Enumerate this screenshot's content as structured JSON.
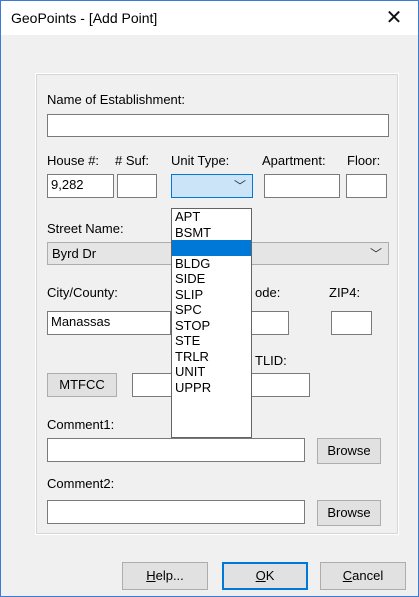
{
  "window": {
    "title": "GeoPoints - [Add Point]",
    "close": "✕"
  },
  "labels": {
    "name": "Name of Establishment:",
    "house": "House #:",
    "suf": "# Suf:",
    "unit_type": "Unit Type:",
    "apartment": "Apartment:",
    "floor": "Floor:",
    "street": "Street Name:",
    "city": "City/County:",
    "zip_code_partial": "ode:",
    "zip4": "ZIP4:",
    "tlid_partial": "TLID:",
    "comment1": "Comment1:",
    "comment2": "Comment2:"
  },
  "fields": {
    "name": "",
    "house": "9,282",
    "suf": "",
    "unit_type": "",
    "apartment": "",
    "floor": "",
    "street": "Byrd Dr",
    "city": "Manassas",
    "zip_partial": "0",
    "zip4": "",
    "mtfcc_value": "",
    "tlid": "",
    "comment1": "",
    "comment2": ""
  },
  "buttons": {
    "mtfcc": "MTFCC",
    "browse1": "Browse",
    "browse2": "Browse",
    "help": "Help...",
    "help_mnemonic": "H",
    "help_rest": "elp...",
    "ok": "OK",
    "ok_mnemonic": "O",
    "ok_rest": "K",
    "cancel": "Cancel",
    "cancel_mnemonic": "C",
    "cancel_rest": "ancel"
  },
  "unit_type_options": [
    "APT",
    "BSMT",
    "",
    "BLDG",
    "SIDE",
    "SLIP",
    "SPC",
    "STOP",
    "STE",
    "TRLR",
    "UNIT",
    "UPPR"
  ],
  "selected_option_index": 2,
  "icons": {
    "dropdown_arrow": "chevron-down-icon"
  }
}
